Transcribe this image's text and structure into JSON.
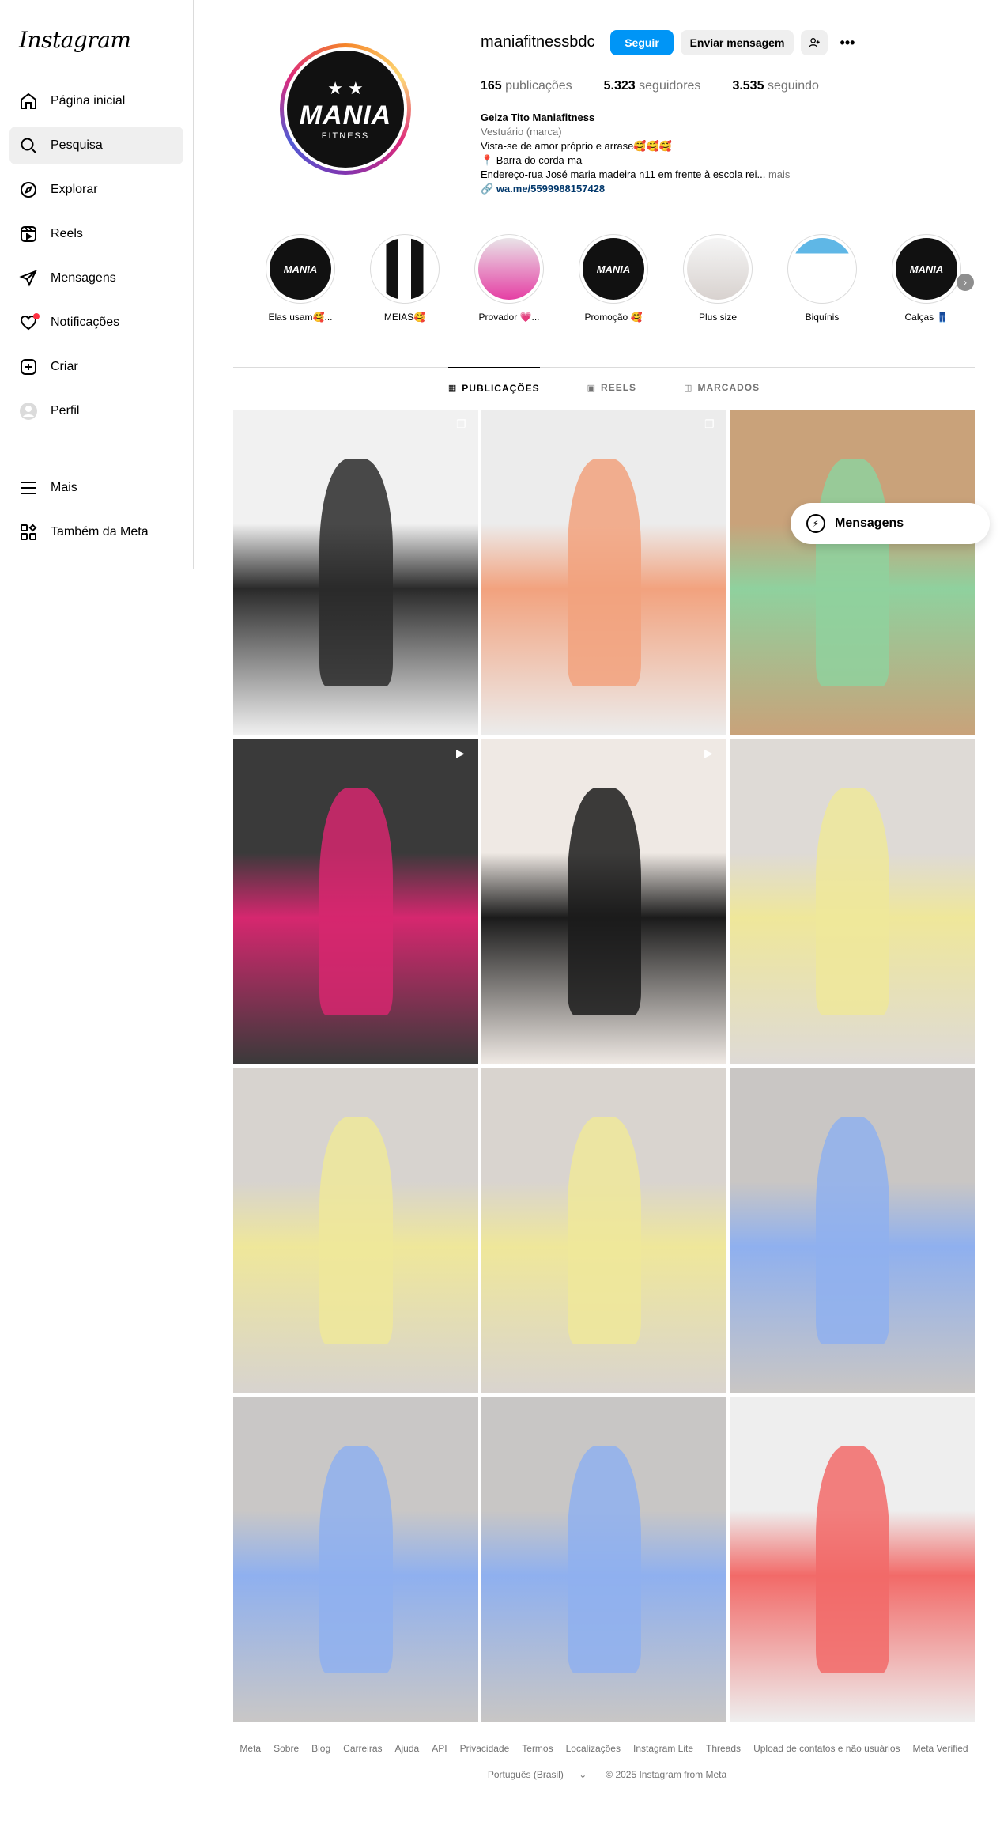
{
  "app": {
    "logo": "Instagram"
  },
  "sidebar": {
    "items": [
      {
        "label": "Página inicial",
        "icon": "home-icon"
      },
      {
        "label": "Pesquisa",
        "icon": "search-icon",
        "active": true
      },
      {
        "label": "Explorar",
        "icon": "compass-icon"
      },
      {
        "label": "Reels",
        "icon": "reels-icon"
      },
      {
        "label": "Mensagens",
        "icon": "send-icon"
      },
      {
        "label": "Notificações",
        "icon": "heart-icon"
      },
      {
        "label": "Criar",
        "icon": "plus-icon"
      },
      {
        "label": "Perfil",
        "icon": "avatar-icon"
      }
    ],
    "bottom": [
      {
        "label": "Mais",
        "icon": "menu-icon"
      },
      {
        "label": "Também da Meta",
        "icon": "meta-apps-icon"
      }
    ]
  },
  "profile": {
    "avatar_text": "MANIA",
    "avatar_sub": "FITNESS",
    "username": "maniafitnessbdc",
    "follow_label": "Seguir",
    "message_label": "Enviar mensagem",
    "stats": {
      "posts_count": "165",
      "posts_label": "publicações",
      "followers_count": "5.323",
      "followers_label": "seguidores",
      "following_count": "3.535",
      "following_label": "seguindo"
    },
    "bio": {
      "name": "Geiza Tito Maniafitness",
      "category": "Vestuário (marca)",
      "line1": "Vista-se de amor próprio e arrase🥰🥰🥰",
      "line2": "📍 Barra do corda-ma",
      "line3": "Endereço-rua José maria madeira n11 em frente à escola rei...",
      "more": "mais",
      "link": "wa.me/5599988157428"
    }
  },
  "highlights": [
    {
      "label": "Elas usam🥰...",
      "thumb": "MANIA"
    },
    {
      "label": "MEIAS🥰",
      "thumb": ""
    },
    {
      "label": "Provador 💗...",
      "thumb": ""
    },
    {
      "label": "Promoção 🥰",
      "thumb": "MANIA"
    },
    {
      "label": "Plus size",
      "thumb": ""
    },
    {
      "label": "Biquínis",
      "thumb": ""
    },
    {
      "label": "Calças 👖",
      "thumb": "MANIA"
    }
  ],
  "tabs": [
    {
      "label": "PUBLICAÇÕES",
      "icon": "grid-icon",
      "active": true
    },
    {
      "label": "REELS",
      "icon": "reels-icon"
    },
    {
      "label": "MARCADOS",
      "icon": "tagged-icon"
    }
  ],
  "posts": [
    {
      "colors": [
        "#f1f1f1",
        "#2a2a2a"
      ],
      "badge": "carousel"
    },
    {
      "colors": [
        "#ececec",
        "#f2a27e"
      ],
      "badge": "carousel"
    },
    {
      "colors": [
        "#c9a27a",
        "#8fd19e"
      ],
      "badge": ""
    },
    {
      "colors": [
        "#3a3a3a",
        "#d6276f"
      ],
      "badge": "reel"
    },
    {
      "colors": [
        "#efe9e4",
        "#1b1b1b"
      ],
      "badge": "reel"
    },
    {
      "colors": [
        "#dedad6",
        "#efe79a"
      ],
      "badge": ""
    },
    {
      "colors": [
        "#d7d3cf",
        "#efe79a"
      ],
      "badge": ""
    },
    {
      "colors": [
        "#d9d4cf",
        "#efe79a"
      ],
      "badge": ""
    },
    {
      "colors": [
        "#c9c6c4",
        "#8fb0ef"
      ],
      "badge": ""
    },
    {
      "colors": [
        "#c9c7c6",
        "#8fb0ef"
      ],
      "badge": ""
    },
    {
      "colors": [
        "#c8c6c5",
        "#8fb0ef"
      ],
      "badge": ""
    },
    {
      "colors": [
        "#eeeeee",
        "#f26a68"
      ],
      "badge": ""
    }
  ],
  "floating_messages": {
    "label": "Mensagens"
  },
  "footer": {
    "links": [
      "Meta",
      "Sobre",
      "Blog",
      "Carreiras",
      "Ajuda",
      "API",
      "Privacidade",
      "Termos",
      "Localizações",
      "Instagram Lite",
      "Threads",
      "Upload de contatos e não usuários",
      "Meta Verified"
    ],
    "language": "Português (Brasil)",
    "copyright": "© 2025 Instagram from Meta"
  }
}
